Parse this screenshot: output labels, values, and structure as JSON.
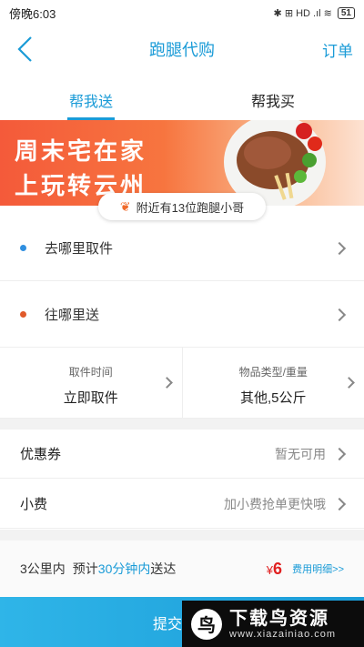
{
  "status_bar": {
    "time": "傍晚6:03",
    "indicators": "✱ ⊞ HD .ıl ≋",
    "battery": "51"
  },
  "nav": {
    "title": "跑腿代购",
    "orders_label": "订单",
    "back_icon": "chevron-left-icon"
  },
  "tabs": [
    {
      "label": "帮我送",
      "active": true
    },
    {
      "label": "帮我买",
      "active": false
    }
  ],
  "banner": {
    "line1": "周末宅在家",
    "line2": "上玩转云州"
  },
  "nearby": {
    "text": "附近有13位跑腿小哥"
  },
  "addresses": {
    "pickup": {
      "label": "去哪里取件",
      "dot_color": "#2f8fe0"
    },
    "deliver": {
      "label": "往哪里送",
      "dot_color": "#e05a2a"
    }
  },
  "info": {
    "pickup_time": {
      "label": "取件时间",
      "value": "立即取件"
    },
    "item_type": {
      "label": "物品类型/重量",
      "value": "其他,5公斤"
    }
  },
  "options": {
    "coupon": {
      "label": "优惠券",
      "value": "暂无可用"
    },
    "tip": {
      "label": "小费",
      "value": "加小费抢单更快哦"
    }
  },
  "summary": {
    "distance": "3公里内",
    "estimate_prefix": "预计",
    "estimate_highlight": "30分钟内",
    "estimate_suffix": "送达",
    "currency": "¥",
    "price": "6",
    "fee_detail": "费用明细>>"
  },
  "submit": {
    "label": "提交"
  },
  "watermark": {
    "title": "下载鸟资源",
    "url": "www.xiazainiao.com"
  },
  "colors": {
    "accent": "#1a9bd7",
    "price": "#e02020"
  }
}
